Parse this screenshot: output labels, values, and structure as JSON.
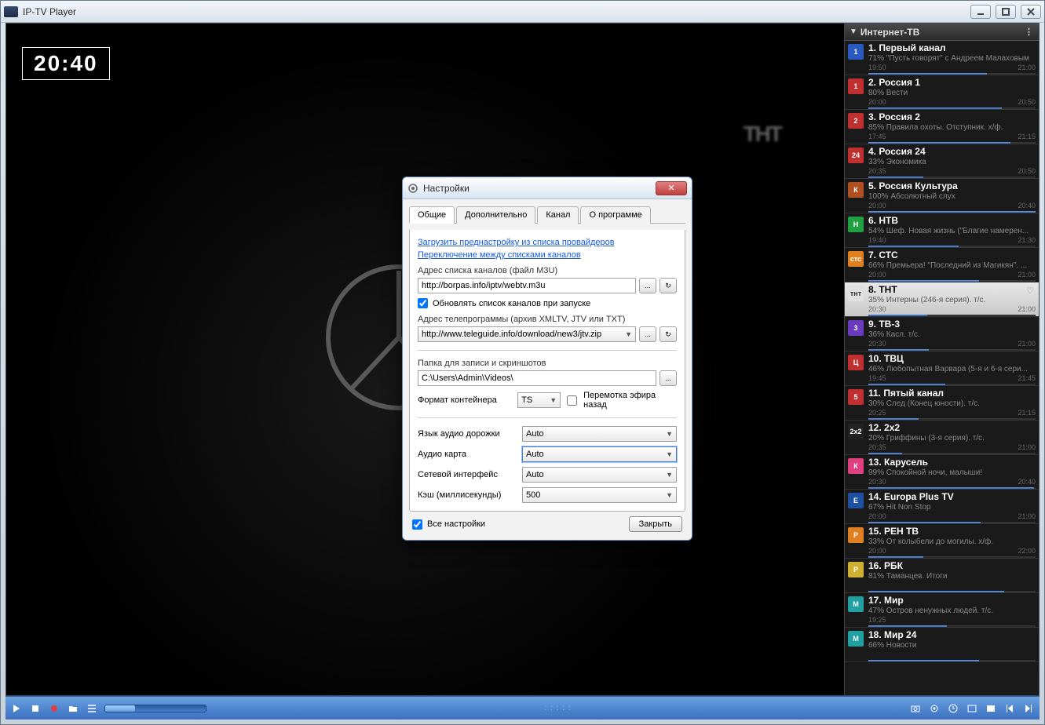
{
  "window": {
    "title": "IP-TV Player"
  },
  "osd": {
    "clock": "20:40",
    "channel_logo": "ТНТ"
  },
  "sidebar": {
    "title": "Интернет-ТВ",
    "channels": [
      {
        "name": "1. Первый канал",
        "prog": "71% \"Пусть говорят\" с Андреем Малаховым",
        "t1": "19:50",
        "t2": "21:00",
        "pct": 71,
        "color": "#2a5abf",
        "icon_text": "1"
      },
      {
        "name": "2. Россия 1",
        "prog": "80% Вести",
        "t1": "20:00",
        "t2": "20:50",
        "pct": 80,
        "color": "#c03030",
        "icon_text": "1"
      },
      {
        "name": "3. Россия 2",
        "prog": "85% Правила охоты. Отступник. х/ф.",
        "t1": "17:45",
        "t2": "21:15",
        "pct": 85,
        "color": "#c03030",
        "icon_text": "2"
      },
      {
        "name": "4. Россия 24",
        "prog": "33% Экономика",
        "t1": "20:35",
        "t2": "20:50",
        "pct": 33,
        "color": "#c03030",
        "icon_text": "24"
      },
      {
        "name": "5. Россия Культура",
        "prog": "100% Абсолютный слух",
        "t1": "20:00",
        "t2": "20:40",
        "pct": 100,
        "color": "#b05020",
        "icon_text": "К"
      },
      {
        "name": "6. НТВ",
        "prog": "54% Шеф. Новая жизнь (\"Благие намерен...",
        "t1": "19:40",
        "t2": "21:30",
        "pct": 54,
        "color": "#20a040",
        "icon_text": "Н"
      },
      {
        "name": "7. СТС",
        "prog": "66% Премьера! \"Последний из Магикян\". ...",
        "t1": "20:00",
        "t2": "21:00",
        "pct": 66,
        "color": "#e08020",
        "icon_text": "стс"
      },
      {
        "name": "8. ТНТ",
        "prog": "35% Интерны (246-я серия). т/с.",
        "t1": "20:30",
        "t2": "21:00",
        "pct": 35,
        "color": "#e0e0e0",
        "icon_text": "тнт",
        "selected": true
      },
      {
        "name": "9. ТВ-3",
        "prog": "36% Касл. т/с.",
        "t1": "20:30",
        "t2": "21:00",
        "pct": 36,
        "color": "#6a3abf",
        "icon_text": "3"
      },
      {
        "name": "10. ТВЦ",
        "prog": "46% Любопытная Варвара (5-я и 6-я сери...",
        "t1": "19:45",
        "t2": "21:45",
        "pct": 46,
        "color": "#c03030",
        "icon_text": "Ц"
      },
      {
        "name": "11. Пятый канал",
        "prog": "30% След (Конец юности). т/с.",
        "t1": "20:25",
        "t2": "21:15",
        "pct": 30,
        "color": "#c03030",
        "icon_text": "5"
      },
      {
        "name": "12. 2х2",
        "prog": "20% Гриффины (3-я серия). т/с.",
        "t1": "20:35",
        "t2": "21:00",
        "pct": 20,
        "color": "#222",
        "icon_text": "2x2"
      },
      {
        "name": "13. Карусель",
        "prog": "99% Спокойной ночи, малыши!",
        "t1": "20:30",
        "t2": "20:40",
        "pct": 99,
        "color": "#e04080",
        "icon_text": "К"
      },
      {
        "name": "14. Europa Plus TV",
        "prog": "67% Hit Non Stop",
        "t1": "20:00",
        "t2": "21:00",
        "pct": 67,
        "color": "#2050a0",
        "icon_text": "E"
      },
      {
        "name": "15. РЕН ТВ",
        "prog": "33% От колыбели до могилы. х/ф.",
        "t1": "20:00",
        "t2": "22:00",
        "pct": 33,
        "color": "#e08020",
        "icon_text": "Р"
      },
      {
        "name": "16. РБК",
        "prog": "81% Таманцев. Итоги",
        "t1": "",
        "t2": "",
        "pct": 81,
        "color": "#d0b030",
        "icon_text": "Р"
      },
      {
        "name": "17. Мир",
        "prog": "47% Остров ненужных людей. т/с.",
        "t1": "19:25",
        "t2": "",
        "pct": 47,
        "color": "#20a0a0",
        "icon_text": "М"
      },
      {
        "name": "18. Мир 24",
        "prog": "66% Новости",
        "t1": "",
        "t2": "",
        "pct": 66,
        "color": "#20a0a0",
        "icon_text": "М"
      }
    ]
  },
  "dialog": {
    "title": "Настройки",
    "tabs": {
      "t1": "Общие",
      "t2": "Дополнительно",
      "t3": "Канал",
      "t4": "О программе"
    },
    "link1": "Загрузить преднастройку из списка провайдеров",
    "link2": "Переключение между списками каналов",
    "lbl_m3u": "Адрес списка каналов (файл M3U)",
    "val_m3u": "http://borpas.info/iptv/webtv.m3u",
    "chk_update": "Обновлять список каналов при запуске",
    "lbl_epg": "Адрес телепрограммы (архив XMLTV, JTV или TXT)",
    "val_epg": "http://www.teleguide.info/download/new3/jtv.zip",
    "lbl_folder": "Папка для записи и скриншотов",
    "val_folder": "C:\\Users\\Admin\\Videos\\",
    "lbl_container": "Формат контейнера",
    "val_container": "TS",
    "chk_rewind": "Перемотка эфира назад",
    "lbl_audio_lang": "Язык аудио дорожки",
    "val_audio_lang": "Auto",
    "lbl_audio_card": "Аудио карта",
    "val_audio_card": "Auto",
    "lbl_net_iface": "Сетевой интерфейс",
    "val_net_iface": "Auto",
    "lbl_cache": "Кэш (миллисекунды)",
    "val_cache": "500",
    "chk_all": "Все настройки",
    "btn_close": "Закрыть"
  }
}
